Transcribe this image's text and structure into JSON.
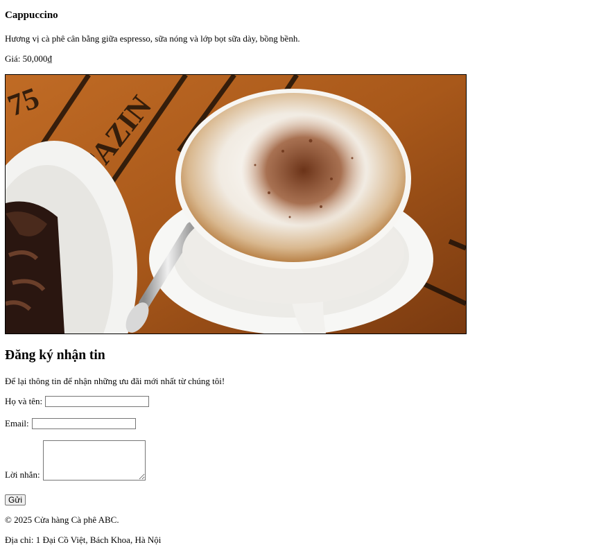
{
  "product": {
    "name": "Cappuccino",
    "description": "Hương vị cà phê cân bằng giữa espresso, sữa nóng và lớp bọt sữa dày, bồng bềnh.",
    "price": "Giá: 50,000₫"
  },
  "newsletter": {
    "heading": "Đăng ký nhận tin",
    "subtitle": "Để lại thông tin để nhận những ưu đãi mới nhất từ chúng tôi!",
    "name_label": "Họ và tên:",
    "name_value": "",
    "email_label": "Email:",
    "email_value": "",
    "message_label": "Lời nhắn:",
    "message_value": "",
    "submit_label": "Gửi"
  },
  "footer": {
    "copyright": "© 2025 Cửa hàng Cà phê ABC.",
    "address": "Địa chỉ: 1 Đại Cồ Việt, Bách Khoa, Hà Nội"
  },
  "colors": {
    "table_wood": "#a8621f",
    "foam": "#f4efe6",
    "cocoa": "#7a3e22",
    "crema": "#c8955c"
  }
}
